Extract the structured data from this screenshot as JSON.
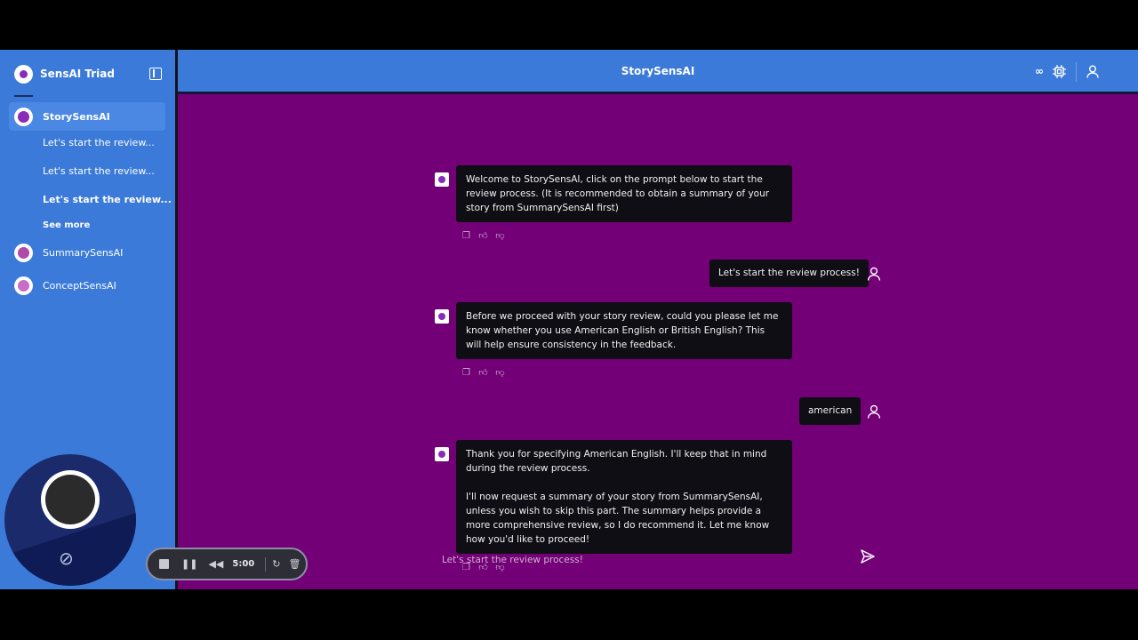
{
  "sidebar": {
    "app_name": "SensAI Triad",
    "items": [
      {
        "label": "StorySensAI",
        "color": "#8a2ab8"
      },
      {
        "label": "SummarySensAI",
        "color": "#b04aaa"
      },
      {
        "label": "ConceptSensAI",
        "color": "#c86ec8"
      }
    ],
    "sub_items": [
      "Let's start the review...",
      "Let's start the review...",
      "Let's start the review..."
    ],
    "see_more": "See more"
  },
  "header": {
    "title": "StorySensAI",
    "icons": [
      "infinity-icon",
      "cpu-icon",
      "user-icon"
    ]
  },
  "chat": {
    "messages": [
      {
        "role": "bot",
        "text": "Welcome to StorySensAI, click on the prompt below to start the review process. (It is recommended to obtain a summary of your story from SummarySensAI first)"
      },
      {
        "role": "user",
        "text": "Let's start the review process!"
      },
      {
        "role": "bot",
        "text": "Before we proceed with your story review, could you please let me know whether you use American English or British English? This will help ensure consistency in the feedback."
      },
      {
        "role": "user",
        "text": "american"
      },
      {
        "role": "bot",
        "text": "Thank you for specifying American English. I'll keep that in mind during the review process.\n\nI'll now request a summary of your story from SummarySensAI, unless you wish to skip this part. The summary helps provide a more comprehensive review, so I do recommend it. Let me know how you'd like to proceed!"
      }
    ],
    "input_placeholder": "Let's start the review process!"
  },
  "recorder": {
    "time": "5:00"
  },
  "colors": {
    "sidebar": "#3b7ad9",
    "main": "#730076",
    "bubble": "#0e0e14"
  }
}
